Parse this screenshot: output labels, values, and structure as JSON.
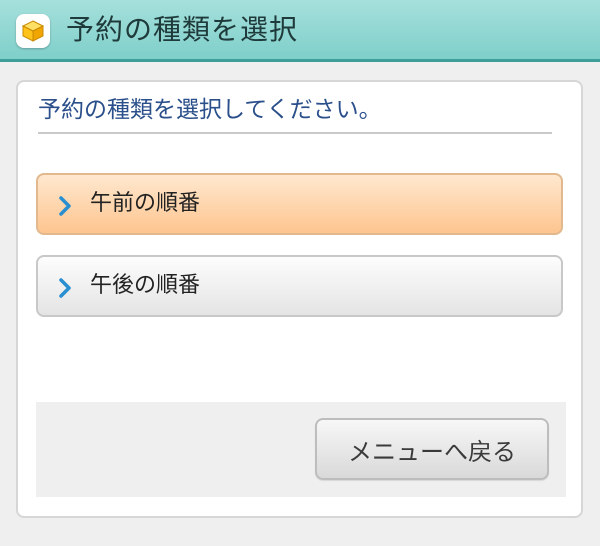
{
  "header": {
    "title": "予約の種類を選択",
    "icon": "cube-icon",
    "background": "#8dd6d1"
  },
  "panel": {
    "heading": "予約の種類を選択してください。"
  },
  "options": [
    {
      "label": "午前の順番",
      "icon": "chevron-right-icon",
      "highlighted": true
    },
    {
      "label": "午後の順番",
      "icon": "chevron-right-icon",
      "highlighted": false
    }
  ],
  "footer": {
    "back_label": "メニューへ戻る"
  },
  "colors": {
    "accent_blue": "#2a4f8a",
    "chevron": "#2a8fd0",
    "highlight_orange": "#fdc58f"
  }
}
